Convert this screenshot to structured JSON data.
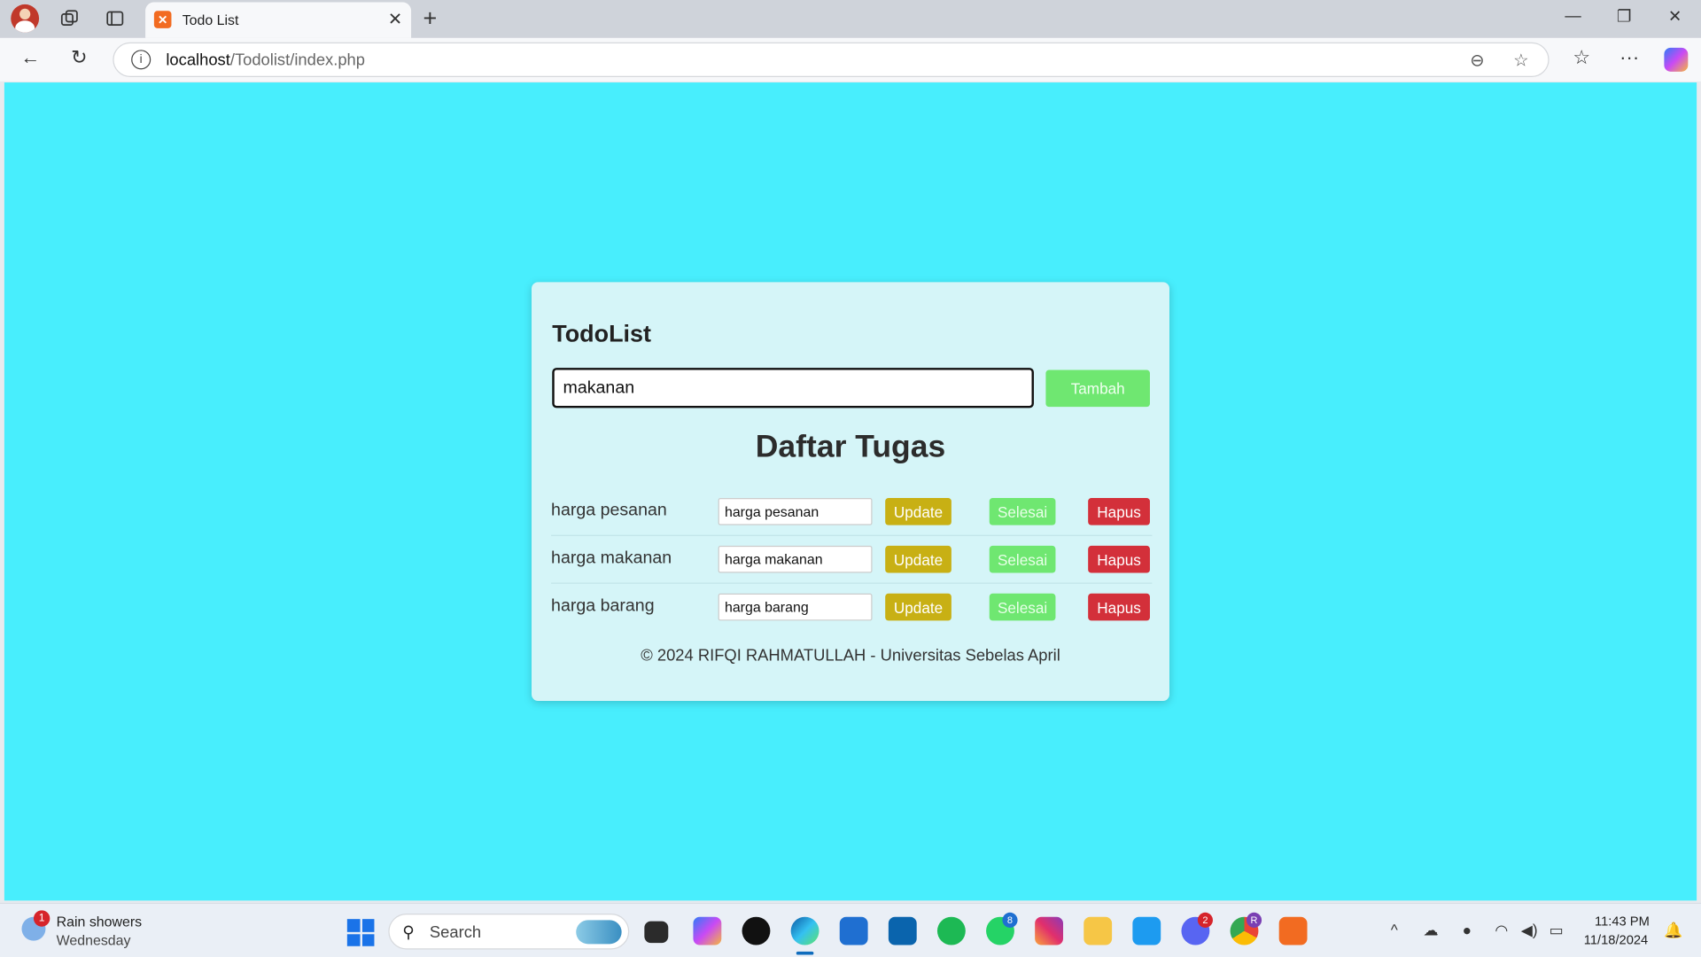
{
  "browser": {
    "tab_title": "Todo List",
    "url_host": "localhost",
    "url_path": "/Todolist/index.php"
  },
  "app": {
    "title": "TodoList",
    "input_value": "makanan",
    "add_label": "Tambah",
    "list_title": "Daftar Tugas",
    "tasks": [
      {
        "text": "harga pesanan",
        "edit_value": "harga pesanan",
        "update_label": "Update",
        "done_label": "Selesai",
        "delete_label": "Hapus"
      },
      {
        "text": "harga makanan",
        "edit_value": "harga makanan",
        "update_label": "Update",
        "done_label": "Selesai",
        "delete_label": "Hapus"
      },
      {
        "text": "harga barang",
        "edit_value": "harga barang",
        "update_label": "Update",
        "done_label": "Selesai",
        "delete_label": "Hapus"
      }
    ],
    "footer": "© 2024 RIFQI RAHMATULLAH - Universitas Sebelas April"
  },
  "colors": {
    "page_bg": "#48eefd",
    "card_bg": "#d5f5f8",
    "add_button": "#6fe771",
    "update_button": "#c8b014",
    "done_button": "#6fe771",
    "delete_button": "#d3303a"
  },
  "taskbar": {
    "weather_badge": "1",
    "weather_line1": "Rain showers",
    "weather_line2": "Wednesday",
    "search_label": "Search",
    "whatsapp_badge": "8",
    "discord_badge": "2",
    "chrome_badge": "R",
    "time": "11:43 PM",
    "date": "11/18/2024"
  }
}
